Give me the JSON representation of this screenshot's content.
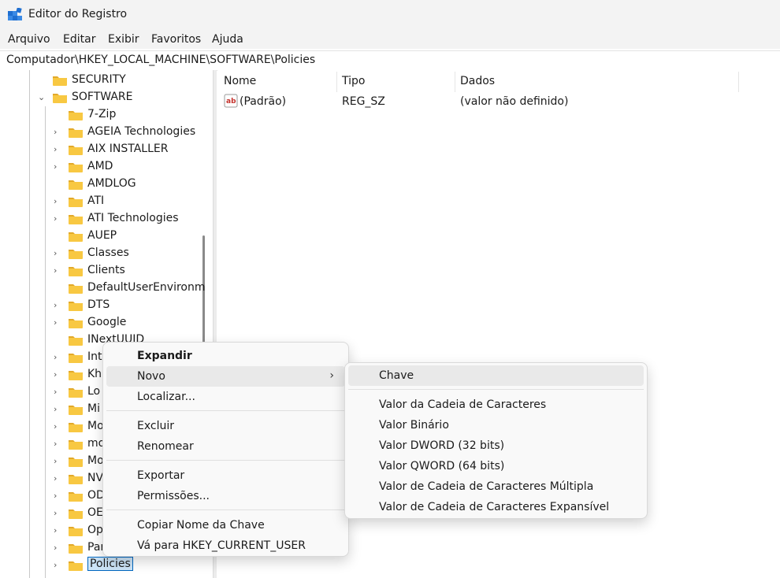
{
  "window": {
    "title": "Editor do Registro"
  },
  "menubar": {
    "items": [
      "Arquivo",
      "Editar",
      "Exibir",
      "Favoritos",
      "Ajuda"
    ]
  },
  "address": {
    "path": "Computador\\HKEY_LOCAL_MACHINE\\SOFTWARE\\Policies"
  },
  "tree": {
    "items": [
      {
        "label": "SECURITY",
        "expander": ""
      },
      {
        "label": "SOFTWARE",
        "expander": "expanded"
      },
      {
        "label": "7-Zip",
        "expander": ""
      },
      {
        "label": "AGEIA Technologies",
        "expander": "collapsed"
      },
      {
        "label": "AIX INSTALLER",
        "expander": "collapsed"
      },
      {
        "label": "AMD",
        "expander": "collapsed"
      },
      {
        "label": "AMDLOG",
        "expander": ""
      },
      {
        "label": "ATI",
        "expander": "collapsed"
      },
      {
        "label": "ATI Technologies",
        "expander": "collapsed"
      },
      {
        "label": "AUEP",
        "expander": ""
      },
      {
        "label": "Classes",
        "expander": "collapsed"
      },
      {
        "label": "Clients",
        "expander": "collapsed"
      },
      {
        "label": "DefaultUserEnvironm",
        "expander": ""
      },
      {
        "label": "DTS",
        "expander": "collapsed"
      },
      {
        "label": "Google",
        "expander": "collapsed"
      },
      {
        "label": "INextUUID",
        "expander": ""
      },
      {
        "label": "Int",
        "expander": "collapsed"
      },
      {
        "label": "Kh",
        "expander": "collapsed"
      },
      {
        "label": "Lo",
        "expander": "collapsed"
      },
      {
        "label": "Mi",
        "expander": "collapsed"
      },
      {
        "label": "Mo",
        "expander": "collapsed"
      },
      {
        "label": "mo",
        "expander": "collapsed"
      },
      {
        "label": "Mo",
        "expander": "collapsed"
      },
      {
        "label": "NV",
        "expander": "collapsed"
      },
      {
        "label": "OD",
        "expander": "collapsed"
      },
      {
        "label": "OE",
        "expander": "collapsed"
      },
      {
        "label": "Op",
        "expander": "collapsed"
      },
      {
        "label": "Par",
        "expander": "collapsed"
      },
      {
        "label": "Policies",
        "expander": "collapsed",
        "selected": true
      }
    ]
  },
  "list": {
    "columns": [
      "Nome",
      "Tipo",
      "Dados"
    ],
    "rows": [
      {
        "icon": "ab-string-icon",
        "name": "(Padrão)",
        "type": "REG_SZ",
        "data": "(valor não definido)"
      }
    ]
  },
  "context_menu": {
    "groups": [
      [
        "Expandir",
        "Novo",
        "Localizar..."
      ],
      [
        "Excluir",
        "Renomear"
      ],
      [
        "Exportar",
        "Permissões..."
      ],
      [
        "Copiar Nome da Chave",
        "Vá para HKEY_CURRENT_USER"
      ]
    ],
    "default_item": "Expandir",
    "hovered_item": "Novo"
  },
  "submenu": {
    "items": [
      "Chave",
      "Valor da Cadeia de Caracteres",
      "Valor Binário",
      "Valor DWORD (32 bits)",
      "Valor QWORD (64 bits)",
      "Valor de Cadeia de Caracteres Múltipla",
      "Valor de Cadeia de Caracteres Expansível"
    ],
    "hovered_item": "Chave"
  },
  "colors": {
    "folder": "#f8c842",
    "folder_dark": "#e2a92a",
    "selection_border": "#0067c0",
    "selection_fill": "#cce4f7",
    "ab_icon": "#c4302b"
  }
}
